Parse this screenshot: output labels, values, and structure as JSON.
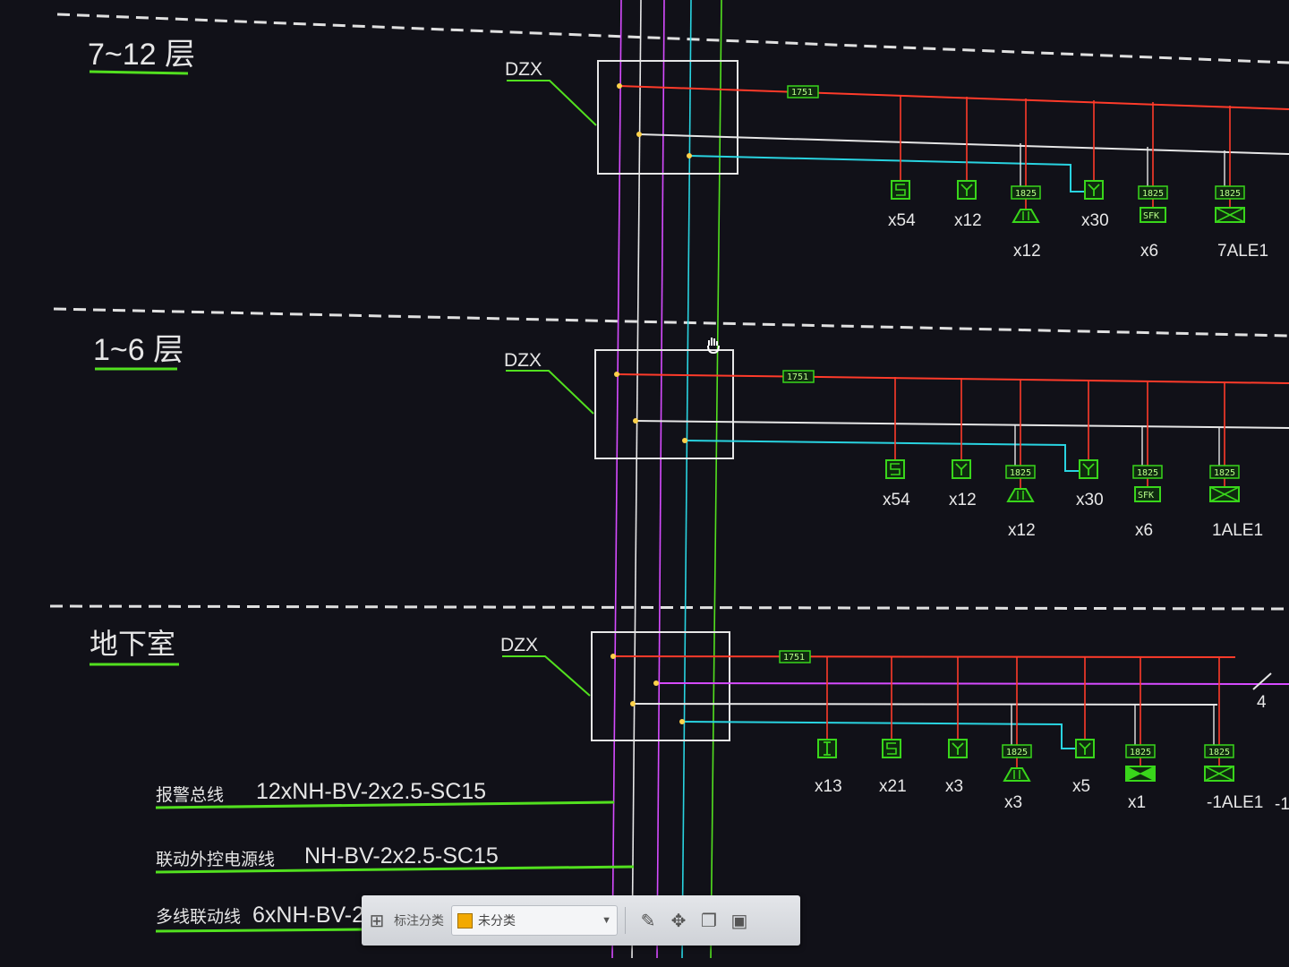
{
  "floors": [
    {
      "label": "7~12 层",
      "box_label": "DZX",
      "cable_tag": "1751",
      "devices": [
        {
          "sym": "s",
          "tag": "",
          "count": "x54"
        },
        {
          "sym": "y",
          "tag": "",
          "count": "x12"
        },
        {
          "sym": "bell",
          "tag": "1825",
          "count": "x12"
        },
        {
          "sym": "y2",
          "tag": "",
          "count": "x30"
        },
        {
          "sym": "sfk",
          "tag": "1825",
          "count": "x6"
        },
        {
          "sym": "x",
          "tag": "1825",
          "count": "7ALE1"
        }
      ]
    },
    {
      "label": "1~6 层",
      "box_label": "DZX",
      "cable_tag": "1751",
      "devices": [
        {
          "sym": "s",
          "tag": "",
          "count": "x54"
        },
        {
          "sym": "y",
          "tag": "",
          "count": "x12"
        },
        {
          "sym": "bell",
          "tag": "1825",
          "count": "x12"
        },
        {
          "sym": "y2",
          "tag": "",
          "count": "x30"
        },
        {
          "sym": "sfk",
          "tag": "1825",
          "count": "x6"
        },
        {
          "sym": "x",
          "tag": "1825",
          "count": "1ALE1"
        }
      ]
    },
    {
      "label": "地下室",
      "box_label": "DZX",
      "cable_tag": "1751",
      "devices": [
        {
          "sym": "i",
          "tag": "",
          "count": "x13"
        },
        {
          "sym": "s",
          "tag": "",
          "count": "x21"
        },
        {
          "sym": "y",
          "tag": "",
          "count": "x3"
        },
        {
          "sym": "bell",
          "tag": "1825",
          "count": "x3"
        },
        {
          "sym": "y2",
          "tag": "",
          "count": "x5"
        },
        {
          "sym": "bowtie",
          "tag": "1825",
          "count": "x1"
        },
        {
          "sym": "x",
          "tag": "1825",
          "count": "-1ALE1"
        }
      ]
    }
  ],
  "basement_side_mark": "4",
  "basement_edge_count": "-1",
  "legend": [
    {
      "name": "报警总线",
      "spec": "12xNH-BV-2x2.5-SC15"
    },
    {
      "name": "联动外控电源线",
      "spec": "NH-BV-2x2.5-SC15"
    },
    {
      "name": "多线联动线",
      "spec": "6xNH-BV-2"
    }
  ],
  "toolbar": {
    "label": "标注分类",
    "selected": "未分类",
    "swatch_color": "#f2a900"
  },
  "colors": {
    "background": "#111118",
    "bus_red": "#ff3b2a",
    "power_white": "#e6e6e6",
    "signal_cyan": "#29d3e0",
    "riser_magenta": "#d64bff",
    "riser_green": "#52e01f",
    "symbol_green": "#39d61b"
  }
}
